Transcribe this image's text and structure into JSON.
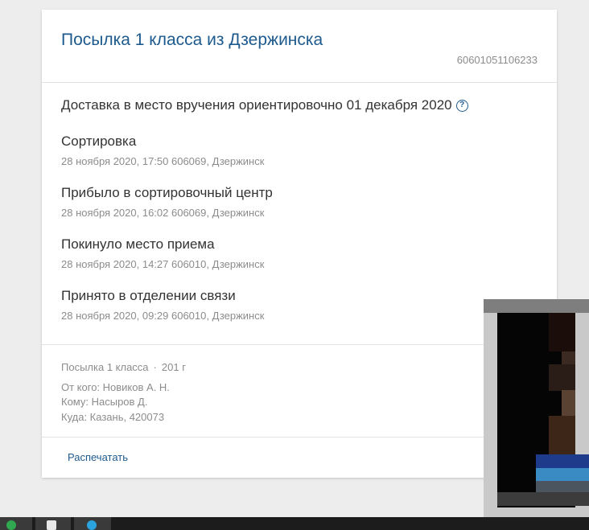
{
  "card": {
    "title": "Посылка 1 класса из Дзержинска",
    "tracking_number": "60601051106233",
    "eta": "Доставка в место вручения ориентировочно 01 декабря 2020",
    "help_glyph": "?",
    "events": [
      {
        "title": "Сортировка",
        "meta": "28 ноября 2020, 17:50 606069, Дзержинск"
      },
      {
        "title": "Прибыло в сортировочный центр",
        "meta": "28 ноября 2020, 16:02 606069, Дзержинск"
      },
      {
        "title": "Покинуло место приема",
        "meta": "28 ноября 2020, 14:27 606010, Дзержинск"
      },
      {
        "title": "Принято в отделении связи",
        "meta": "28 ноября 2020, 09:29 606010, Дзержинск"
      }
    ],
    "parcel": {
      "type": "Посылка 1 класса",
      "separator": "·",
      "weight": "201 г",
      "from": "От кого: Новиков А. Н.",
      "to": "Кому: Насыров Д.",
      "address": "Куда: Казань, 420073"
    },
    "print_label": "Распечатать"
  },
  "colors": {
    "accent": "#1d5a8e",
    "muted": "#8c8c8c",
    "text": "#333333"
  },
  "icons": [
    "help-icon",
    "taskbar-app-icon",
    "taskbar-editor-icon",
    "taskbar-telegram-icon"
  ]
}
